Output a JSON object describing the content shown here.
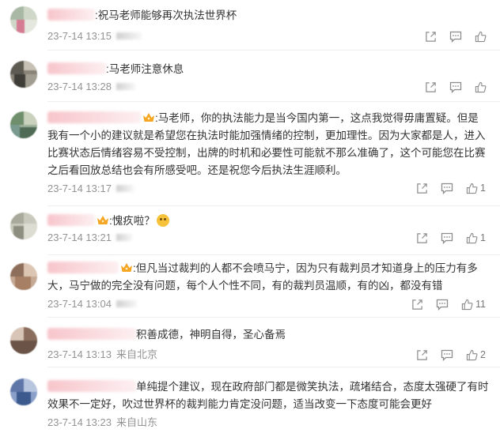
{
  "comments": [
    {
      "text": ":祝马老师能够再次执法世界杯",
      "time": "23-7-14 13:15",
      "location": "",
      "like_count": ""
    },
    {
      "text": ":马老师注意休息",
      "time": "23-7-14 13:28",
      "location": "",
      "like_count": ""
    },
    {
      "text": ":马老师，你的执法能力是当今国内第一，这点我觉得毋庸置疑。但是我有一个小的建议就是希望您在执法时能加强情绪的控制，更加理性。因为大家都是人，进入比赛状态后情绪容易不受控制，出牌的时机和必要性可能就不那么准确了，这个可能您在比赛之后看回放总结也会有所感受吧。还是祝您今后执法生涯顺利。",
      "time": "23-7-14 13:17",
      "location": "",
      "like_count": "1"
    },
    {
      "text": ":愧疚啦？",
      "time": "23-7-14 13:21",
      "location": "",
      "like_count": "1"
    },
    {
      "text": ":但凡当过裁判的人都不会喷马宁，因为只有裁判员才知道身上的压力有多大，马宁做的完全没有问题，每个人个性不同，有的裁判员温顺，有的凶，都没有错",
      "time": "23-7-14 13:04",
      "location": "",
      "like_count": "11"
    },
    {
      "text": "积善成德，神明自得，圣心备焉",
      "time": "23-7-14 13:13",
      "location": "来自北京",
      "like_count": "2"
    },
    {
      "text": "单纯提个建议，现在政府部门都是微笑执法，疏堵结合，态度太强硬了有时效果不一定好，吹过世界杯的裁判能力肯定没问题，适当改变一下态度可能会更好",
      "time": "23-7-14 13:23",
      "location": "来自山东",
      "like_count": ""
    }
  ],
  "icons": [
    "share-icon",
    "comment-icon",
    "like-icon"
  ],
  "colors": {
    "text": "#333333",
    "meta": "#939393",
    "icon": "#8c8c8c",
    "divider": "#eeeeee"
  }
}
